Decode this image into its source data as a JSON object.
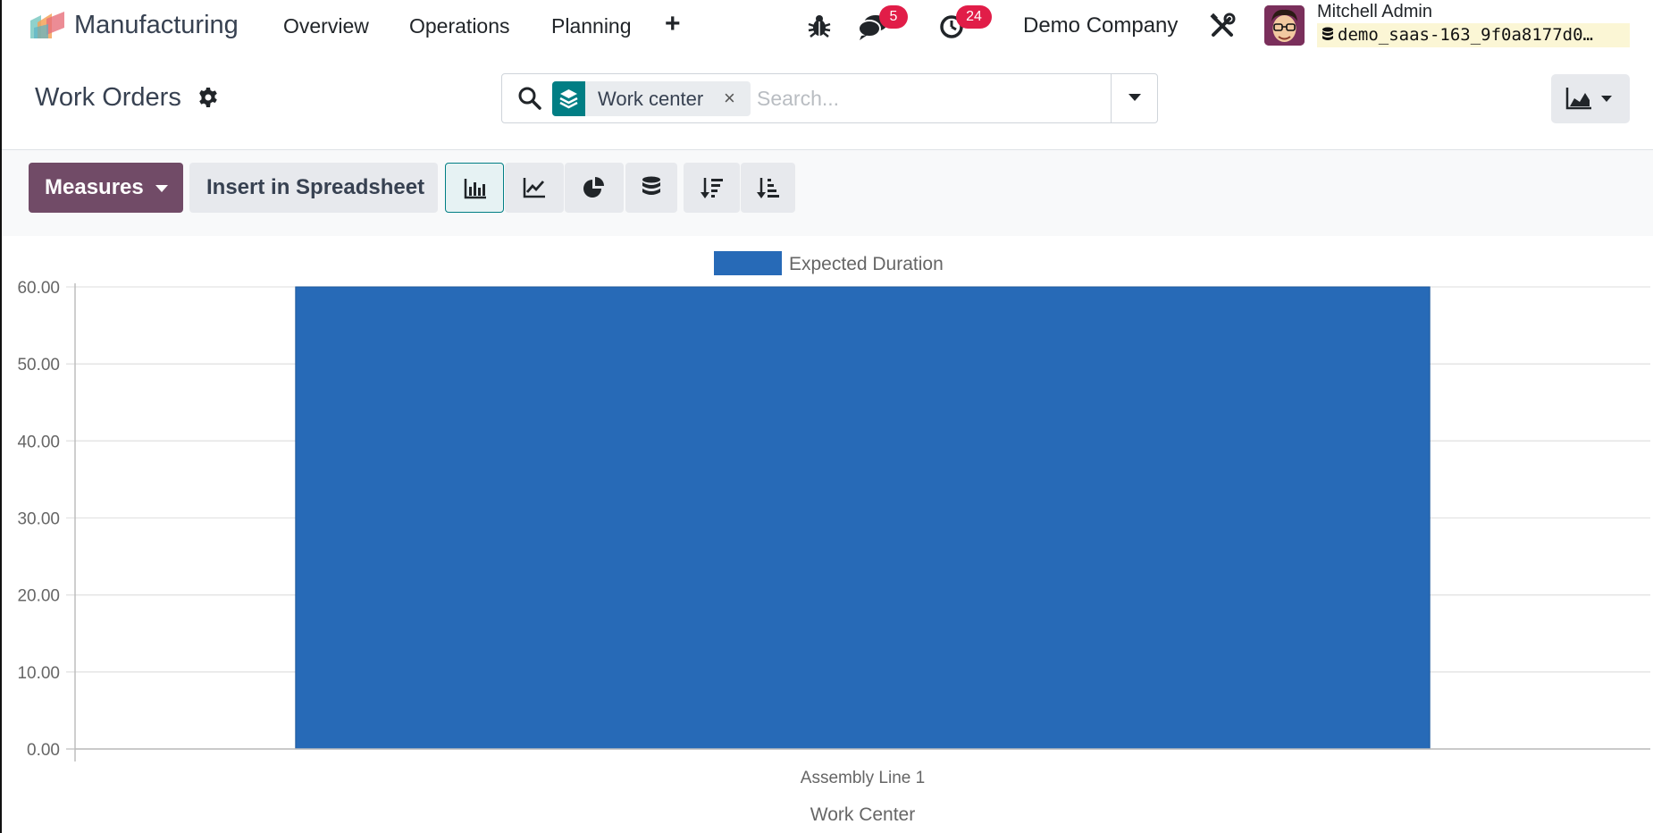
{
  "navbar": {
    "app_name": "Manufacturing",
    "menu": {
      "overview": "Overview",
      "operations": "Operations",
      "planning": "Planning",
      "add": "+"
    },
    "messages_count": "5",
    "activities_count": "24",
    "company": "Demo Company",
    "user_name": "Mitchell Admin",
    "database": "demo_saas-163_9f0a8177d0…",
    "icons": [
      "app-logo",
      "bug-icon",
      "chat-icon",
      "clock-icon",
      "tools-icon",
      "database-icon"
    ]
  },
  "control_panel": {
    "title": "Work Orders",
    "search": {
      "facet_label": "Work center",
      "facet_remove": "×",
      "placeholder": "Search..."
    }
  },
  "toolbar": {
    "measures_label": "Measures",
    "spreadsheet_label": "Insert in Spreadsheet",
    "active_view": "bar",
    "icons": [
      "bar-chart-icon",
      "line-chart-icon",
      "pie-chart-icon",
      "stack-icon",
      "sort-descending-icon",
      "sort-ascending-icon"
    ]
  },
  "colors": {
    "brand": "#714b67",
    "accent": "#017e84",
    "bar": "#276ab7",
    "badge": "#e11d48"
  },
  "chart_data": {
    "type": "bar",
    "categories": [
      "Assembly Line 1"
    ],
    "series": [
      {
        "name": "Expected Duration",
        "values": [
          60
        ]
      }
    ],
    "xlabel": "Work Center",
    "ylabel": "",
    "ylim": [
      0,
      60
    ],
    "y_ticks": [
      0,
      10,
      20,
      30,
      40,
      50,
      60
    ],
    "y_tick_labels": [
      "0.00",
      "10.00",
      "20.00",
      "30.00",
      "40.00",
      "50.00",
      "60.00"
    ],
    "grid": true,
    "legend": "top-center"
  }
}
